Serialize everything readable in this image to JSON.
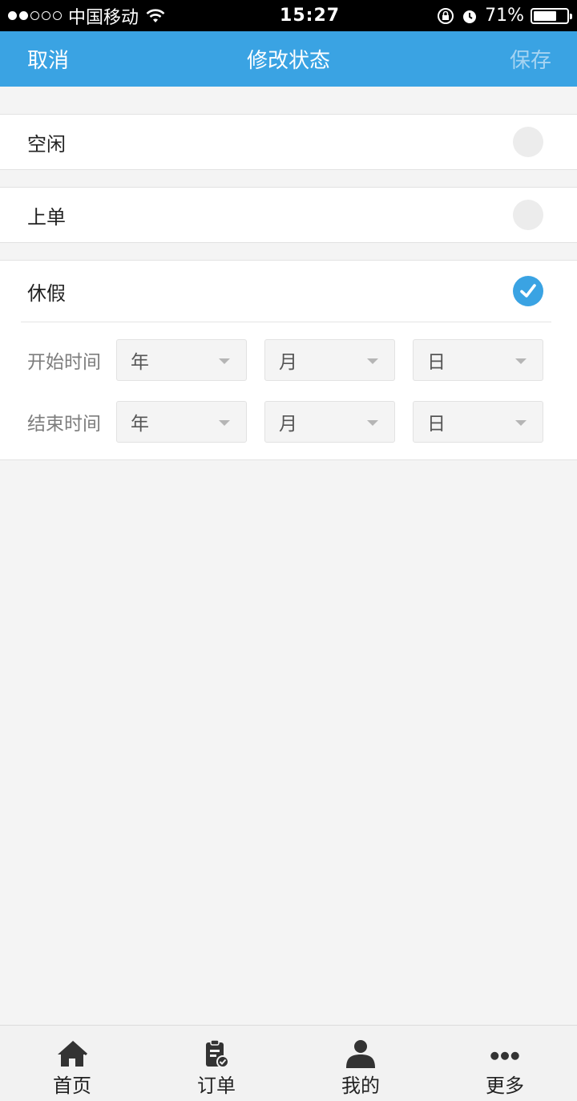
{
  "status_bar": {
    "carrier": "中国移动",
    "time": "15:27",
    "battery_percent": "71%",
    "battery_level": 0.71,
    "signal_bars_filled": 2,
    "signal_bars_total": 5
  },
  "nav": {
    "cancel_label": "取消",
    "title": "修改状态",
    "save_label": "保存"
  },
  "options": [
    {
      "label": "空闲",
      "selected": false
    },
    {
      "label": "上单",
      "selected": false
    },
    {
      "label": "休假",
      "selected": true
    }
  ],
  "vacation": {
    "start_label": "开始时间",
    "end_label": "结束时间",
    "start": {
      "year": "年",
      "month": "月",
      "day": "日"
    },
    "end": {
      "year": "年",
      "month": "月",
      "day": "日"
    }
  },
  "tabs": [
    {
      "label": "首页",
      "icon": "home-icon"
    },
    {
      "label": "订单",
      "icon": "order-icon"
    },
    {
      "label": "我的",
      "icon": "profile-icon"
    },
    {
      "label": "更多",
      "icon": "more-icon"
    }
  ],
  "colors": {
    "accent": "#3aa3e3",
    "background": "#f4f4f4"
  }
}
